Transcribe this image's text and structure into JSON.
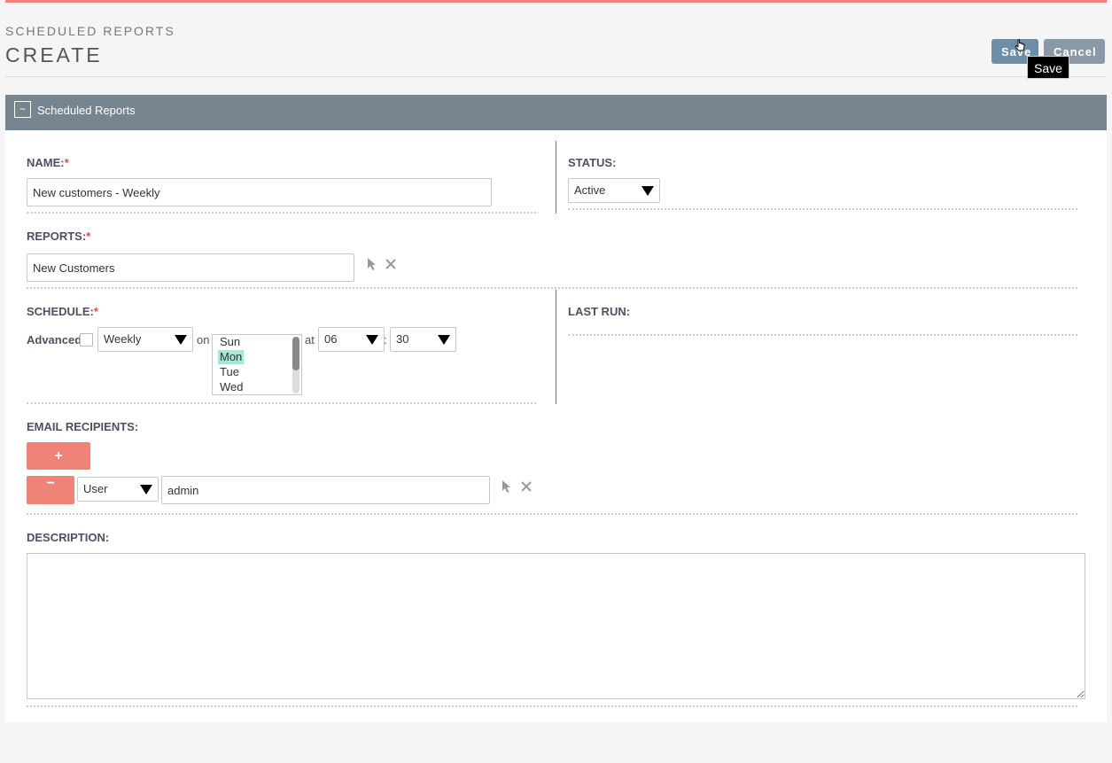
{
  "header": {
    "module_title": "SCHEDULED REPORTS",
    "page_title": "CREATE",
    "save_label": "Save",
    "cancel_label": "Cancel",
    "tooltip": "Save"
  },
  "panel": {
    "collapse_symbol": "−",
    "title": "Scheduled Reports"
  },
  "fields": {
    "name": {
      "label": "NAME:",
      "required": "*",
      "value": "New customers - Weekly"
    },
    "status": {
      "label": "STATUS:",
      "value": "Active"
    },
    "reports": {
      "label": "REPORTS:",
      "required": "*",
      "value": "New Customers"
    },
    "schedule": {
      "label": "SCHEDULE:",
      "required": "*",
      "advanced_label": "Advanced",
      "frequency": "Weekly",
      "on_label": "on",
      "days": [
        "Sun",
        "Mon",
        "Tue",
        "Wed"
      ],
      "selected_day": "Mon",
      "at_label": "at",
      "hour": "06",
      "colon": ":",
      "minute": "30"
    },
    "last_run": {
      "label": "LAST RUN:"
    },
    "email_recipients": {
      "label": "EMAIL RECIPIENTS:",
      "add_symbol": "+",
      "remove_symbol": "−",
      "type": "User",
      "value": "admin"
    },
    "description": {
      "label": "DESCRIPTION:",
      "value": ""
    }
  },
  "colors": {
    "accent": "#f08377",
    "header_bg": "#778591",
    "save_bg": "#6e8ea8",
    "selected_option": "#a5e8d6"
  },
  "icons": [
    "pointer-select-icon",
    "clear-x-icon",
    "hand-cursor-icon"
  ]
}
